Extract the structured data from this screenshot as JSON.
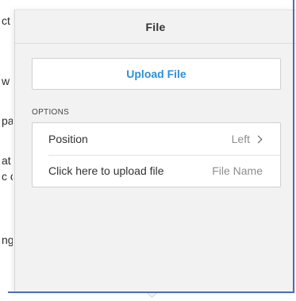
{
  "background_fragments": [
    "ct",
    "w",
    "pa",
    "at",
    "c c",
    "ng"
  ],
  "popover": {
    "title": "File",
    "upload_button_label": "Upload File",
    "options_heading": "OPTIONS",
    "options": [
      {
        "label": "Position",
        "value": "Left",
        "icon": "chevron-right-icon"
      },
      {
        "label": "Click here to upload file",
        "value": "File Name"
      }
    ]
  },
  "colors": {
    "accent": "#2e8fd6",
    "panel_bg": "#f2f2f2",
    "frame_border": "#4a6fb5"
  }
}
